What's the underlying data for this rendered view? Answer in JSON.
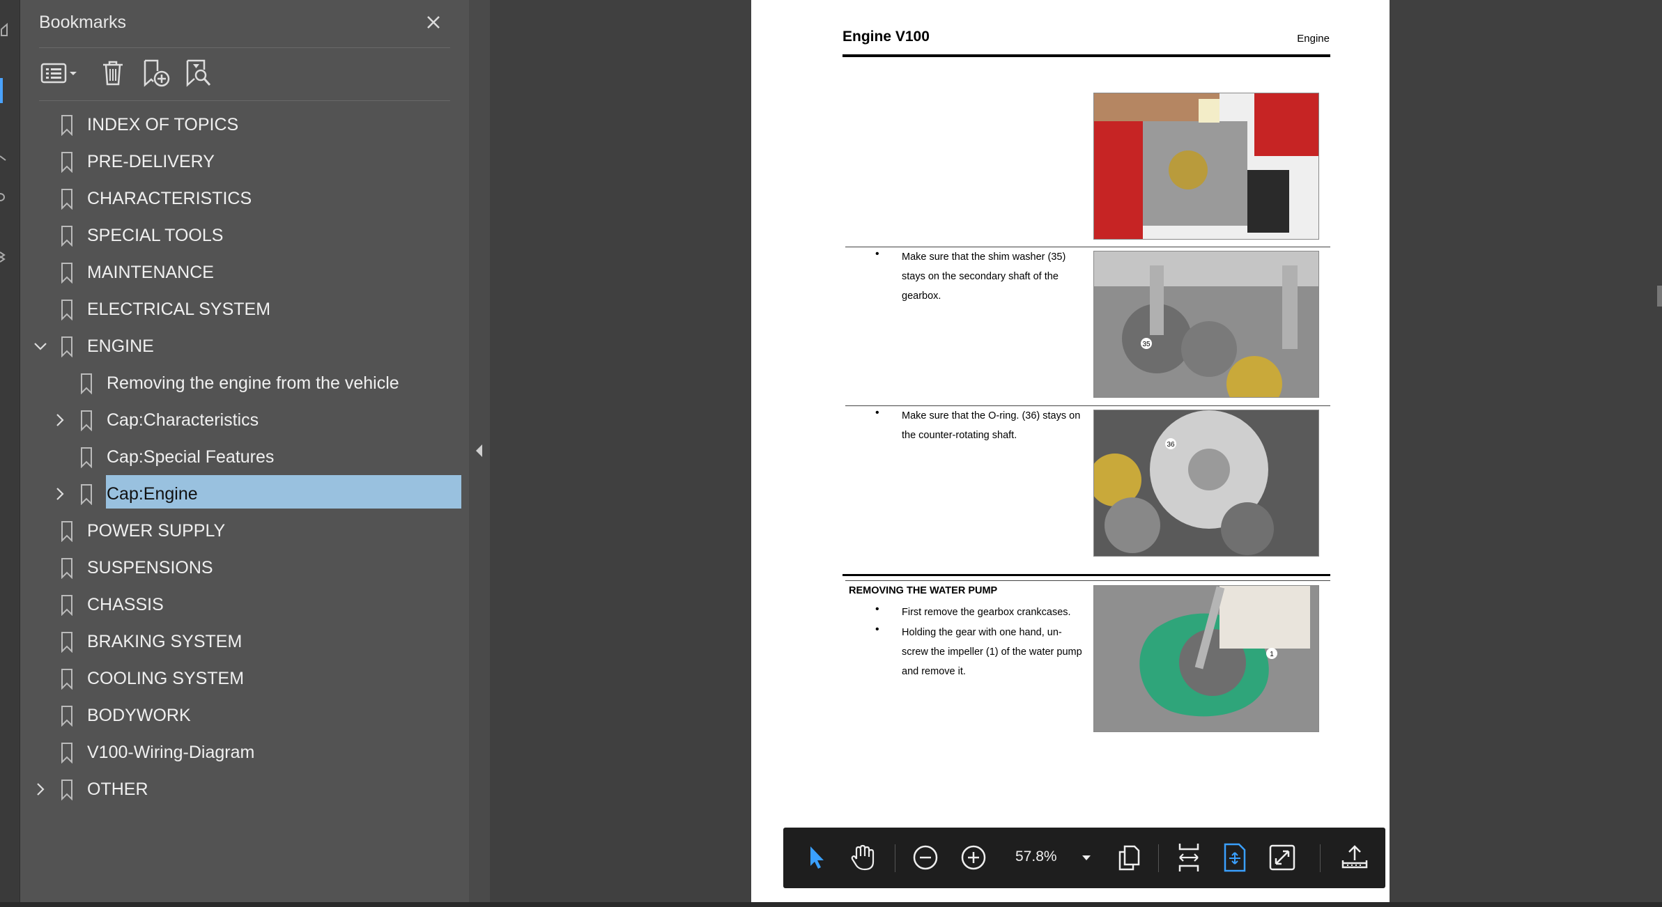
{
  "bookmarks_panel": {
    "title": "Bookmarks",
    "items": [
      {
        "label": "INDEX OF TOPICS"
      },
      {
        "label": "PRE-DELIVERY"
      },
      {
        "label": "CHARACTERISTICS"
      },
      {
        "label": "SPECIAL TOOLS"
      },
      {
        "label": "MAINTENANCE"
      },
      {
        "label": "ELECTRICAL SYSTEM"
      },
      {
        "label": "ENGINE"
      },
      {
        "label": "Removing the engine from the vehicle"
      },
      {
        "label": "Cap:Characteristics"
      },
      {
        "label": "Cap:Special Features"
      },
      {
        "label": "Cap:Engine"
      },
      {
        "label": "POWER SUPPLY"
      },
      {
        "label": "SUSPENSIONS"
      },
      {
        "label": "CHASSIS"
      },
      {
        "label": "BRAKING SYSTEM"
      },
      {
        "label": "COOLING SYSTEM"
      },
      {
        "label": "BODYWORK"
      },
      {
        "label": "V100-Wiring-Diagram"
      },
      {
        "label": "OTHER"
      }
    ]
  },
  "document": {
    "title": "Engine V100",
    "section": "Engine",
    "steps": [
      {
        "bullet": "•",
        "text": "Make sure that the shim washer (35) stays on the secondary shaft of the gearbox.",
        "callout": "35"
      },
      {
        "bullet": "•",
        "text": "Make sure that the O-ring. (36) stays on the counter-rotating shaft.",
        "callout": "36"
      }
    ],
    "subsection_heading": "REMOVING THE WATER PUMP",
    "pump_steps": [
      {
        "bullet": "•",
        "text": "First remove the gearbox crankcases."
      },
      {
        "bullet": "•",
        "text": "Holding the gear with one hand, un-screw the impeller (1) of the water pump and remove it."
      }
    ],
    "pump_callout": "1"
  },
  "floating_toolbar": {
    "zoom_level": "57.8%"
  },
  "colors": {
    "panel_bg": "#535353",
    "selection": "#99c1df",
    "accent": "#4aa3ff",
    "toolbar_bg": "#1e1e1e"
  }
}
